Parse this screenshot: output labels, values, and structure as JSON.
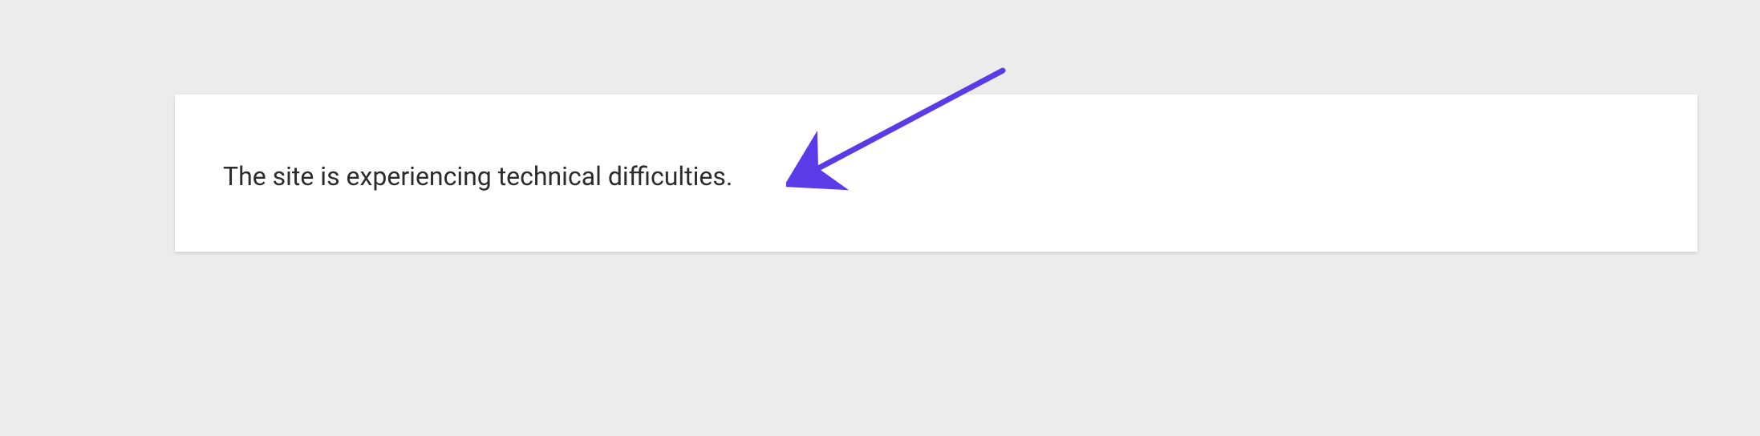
{
  "error": {
    "message": "The site is experiencing technical difficulties."
  },
  "annotation": {
    "arrow_color": "#5b3be8"
  }
}
